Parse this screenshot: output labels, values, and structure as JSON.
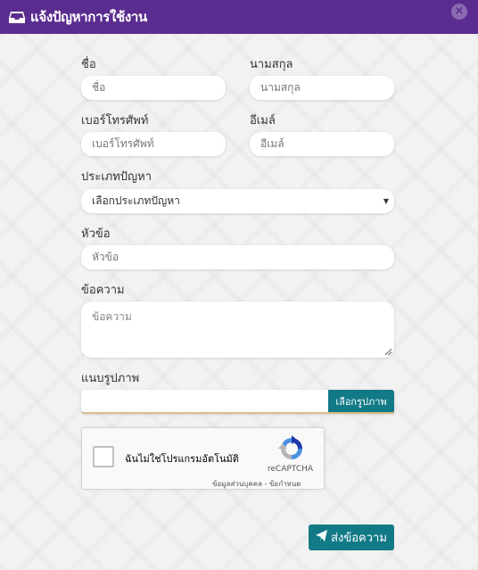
{
  "header": {
    "title": "แจ้งปัญหาการใช้งาน",
    "close_label": "×"
  },
  "form": {
    "first_name": {
      "label": "ชื่อ",
      "placeholder": "ชื่อ"
    },
    "last_name": {
      "label": "นามสกุล",
      "placeholder": "นามสกุล"
    },
    "phone": {
      "label": "เบอร์โทรศัพท์",
      "placeholder": "เบอร์โทรศัพท์"
    },
    "email": {
      "label": "อีเมล์",
      "placeholder": "อีเมล์"
    },
    "problem_type": {
      "label": "ประเภทปัญหา",
      "selected": "เลือกประเภทปัญหา",
      "caret": "▼"
    },
    "subject": {
      "label": "หัวข้อ",
      "placeholder": "หัวข้อ"
    },
    "message": {
      "label": "ข้อความ",
      "placeholder": "ข้อความ"
    },
    "attachment": {
      "label": "แนบรูปภาพ",
      "button_label": "เลือกรูปภาพ"
    }
  },
  "captcha": {
    "text": "ฉันไม่ใช่โปรแกรมอัตโนมัติ",
    "brand": "reCAPTCHA",
    "links": "ข้อมูลส่วนบุคคล - ข้อกำหนด"
  },
  "submit": {
    "label": "ส่งข้อความ"
  },
  "colors": {
    "header": "#5b2c8f",
    "button": "#127a86"
  }
}
